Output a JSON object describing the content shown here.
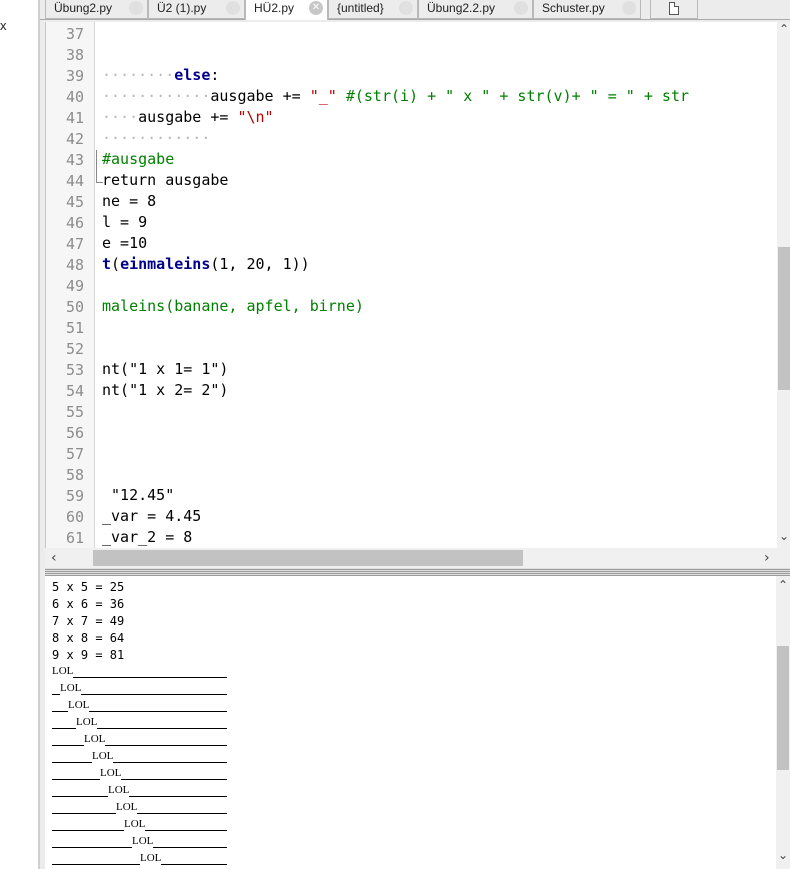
{
  "left_panel": {
    "close_glyph": "x"
  },
  "tabs": [
    {
      "label": "Übung2.py",
      "active": false
    },
    {
      "label": "Ü2 (1).py",
      "active": false
    },
    {
      "label": "HÜ2.py",
      "active": true
    },
    {
      "label": "{untitled}",
      "active": false
    },
    {
      "label": "Übung2.2.py",
      "active": false
    },
    {
      "label": "Schuster.py",
      "active": false
    }
  ],
  "editor": {
    "line_numbers": [
      "37",
      "38",
      "39",
      "40",
      "41",
      "42",
      "43",
      "44",
      "45",
      "46",
      "47",
      "48",
      "49",
      "50",
      "51",
      "52",
      "53",
      "54",
      "55",
      "56",
      "57",
      "58",
      "59",
      "60",
      "61"
    ],
    "lines": {
      "l39": {
        "ws": "········",
        "kw": "else",
        "rest": ":"
      },
      "l40": {
        "ws": "············",
        "a": "ausgabe += ",
        "s1": "\"_\"",
        "c": " #(str(i) + \" x \" + str(v)+ \" = \" + str"
      },
      "l41": {
        "ws": "····",
        "a": "ausgabe += ",
        "s1": "\"\\n\""
      },
      "l42": {
        "ws": "············"
      },
      "l43": {
        "c": "#ausgabe"
      },
      "l44": {
        "kw": "return",
        "rest": " ausgabe"
      },
      "l45": {
        "a": "ne = 8"
      },
      "l46": {
        "a": "l = 9"
      },
      "l47": {
        "a": "e =10"
      },
      "l48": {
        "kw": "t",
        "p1": "(",
        "fn": "einmaleins",
        "rest": "(1, 20, 1))"
      },
      "l50": {
        "c": "maleins(banane, apfel, birne)"
      },
      "l53": {
        "a": "nt(\"1 x 1= 1\")"
      },
      "l54": {
        "a": "nt(\"1 x 2= 2\")"
      },
      "l59": {
        "a": " \"12.45\""
      },
      "l60": {
        "a": "_var = 4.45"
      },
      "l61": {
        "a": "_var_2 = 8"
      }
    }
  },
  "output": {
    "lines": [
      "5 x 5 = 25",
      "6 x 6 = 36",
      "7 x 7 = 49",
      "8 x 8 = 64",
      "9 x 9 = 81"
    ],
    "lol_word": "LOL",
    "lol_rows": 12
  },
  "icons": {
    "scroll_up": "chevron-up-icon",
    "scroll_down": "chevron-down-icon",
    "scroll_left": "chevron-left-icon",
    "scroll_right": "chevron-right-icon",
    "new_tab": "new-document-icon"
  }
}
